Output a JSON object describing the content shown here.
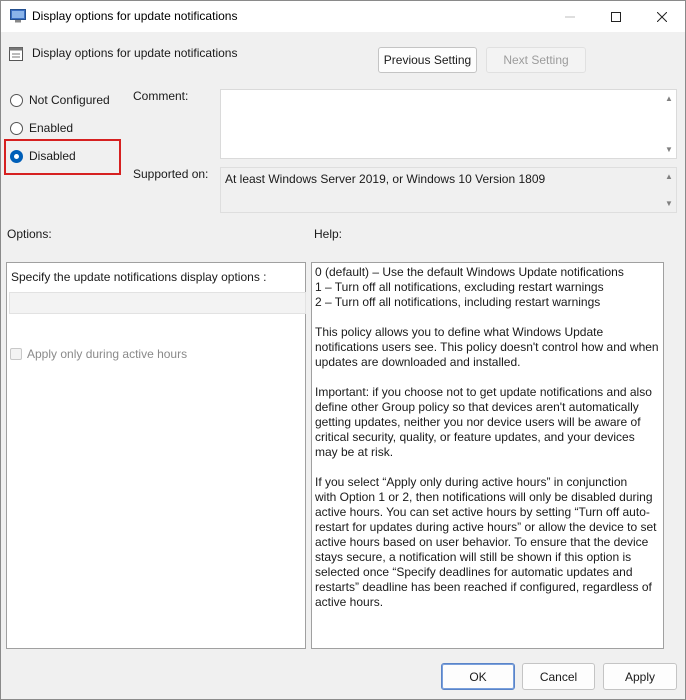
{
  "window": {
    "title": "Display options for update notifications",
    "controls": {
      "minimize": "—",
      "maximize": "☐",
      "close": "✕"
    }
  },
  "header": {
    "title": "Display options for update notifications",
    "prev_button": "Previous Setting",
    "next_button": "Next Setting"
  },
  "state": {
    "options": [
      {
        "label": "Not Configured",
        "checked": false
      },
      {
        "label": "Enabled",
        "checked": false
      },
      {
        "label": "Disabled",
        "checked": true
      }
    ]
  },
  "comment": {
    "label": "Comment:",
    "value": ""
  },
  "supported": {
    "label": "Supported on:",
    "value": "At least Windows Server 2019, or Windows 10 Version 1809"
  },
  "options_panel": {
    "heading": "Options:",
    "description": "Specify the update notifications display options :",
    "dropdown_value": "",
    "checkbox_label": "Apply only during active hours",
    "checkbox_checked": false
  },
  "help_panel": {
    "heading": "Help:",
    "lines": [
      "0 (default) – Use the default Windows Update notifications",
      "1 – Turn off all notifications, excluding restart warnings",
      "2 – Turn off all notifications, including restart warnings",
      "",
      "This policy allows you to define what Windows Update",
      "notifications users see. This policy doesn't control how and when",
      "updates are downloaded and installed.",
      "",
      "Important: if you choose not to get update notifications and also",
      "define other Group policy so that devices aren't automatically",
      "getting updates, neither you nor device users will be aware of",
      "critical security, quality, or feature updates, and your devices",
      "may be at risk.",
      "",
      "If you select “Apply only during active hours” in conjunction",
      "with Option 1 or 2, then notifications will only be disabled during",
      "active hours. You can set active hours by setting “Turn off auto-",
      "restart for updates during active hours” or allow the device to set",
      "active hours based on user behavior. To ensure that the device",
      "stays secure, a notification will still be shown if this option is",
      "selected once “Specify deadlines for automatic updates and",
      "restarts” deadline has been reached if configured, regardless of",
      "active hours."
    ]
  },
  "footer": {
    "ok": "OK",
    "cancel": "Cancel",
    "apply": "Apply"
  },
  "colors": {
    "accent": "#005fb8",
    "highlight_box": "#d62020"
  }
}
